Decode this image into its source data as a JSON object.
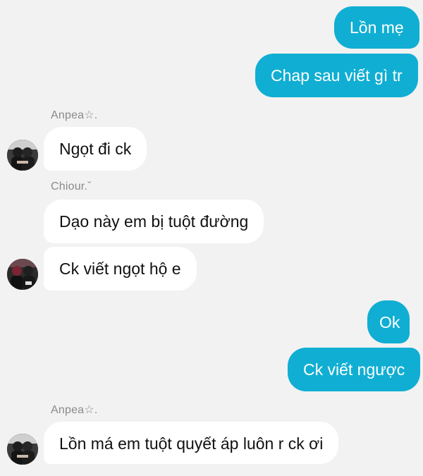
{
  "messages": [
    {
      "text": "Lồn mẹ"
    },
    {
      "text": "Chap sau viết gì tr"
    },
    {
      "sender": "Anpea☆.",
      "text": "Ngọt đi ck"
    },
    {
      "sender": "Chiour.ˇ",
      "text": "Dạo này em bị tuột đường"
    },
    {
      "text": "Ck viết ngọt hộ e"
    },
    {
      "text": "Ok"
    },
    {
      "text": "Ck viết ngược"
    },
    {
      "sender": "Anpea☆.",
      "text": "Lồn má em tuột quyết áp luôn r ck ơi"
    }
  ],
  "colors": {
    "background": "#f2f2f2",
    "outgoing_bubble": "#10aed3",
    "incoming_bubble": "#ffffff"
  }
}
